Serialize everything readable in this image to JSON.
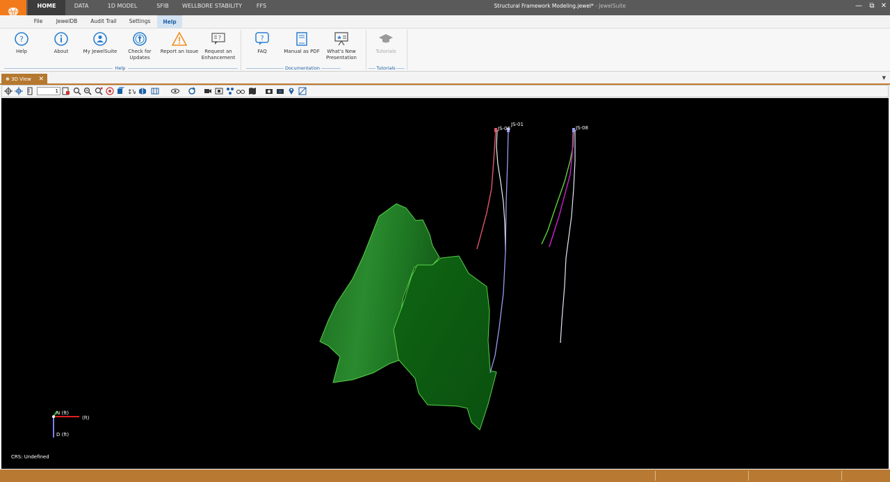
{
  "top_tabs": [
    "HOME",
    "DATA",
    "1D MODEL",
    "SFIB",
    "WELLBORE STABILITY",
    "FFS"
  ],
  "active_top_tab": "HOME",
  "window": {
    "document_title": "Structural Framework Modeling.jewel*",
    "app_name": " - JewelSuite"
  },
  "sub_tabs": [
    "File",
    "JewelDB",
    "Audit Trail",
    "Settings",
    "Help"
  ],
  "active_sub_tab": "Help",
  "ribbon": {
    "help_group": {
      "label": "Help",
      "buttons": [
        {
          "label": "Help",
          "icon": "help-circle-icon"
        },
        {
          "label": "About",
          "icon": "info-circle-icon"
        },
        {
          "label": "My JewelSuite",
          "icon": "user-circle-icon"
        },
        {
          "label": "Check for Updates",
          "icon": "update-arrow-icon"
        },
        {
          "label": "Report an Issue",
          "icon": "warning-triangle-icon"
        },
        {
          "label": "Request an Enhancement",
          "icon": "speech-bubble-icon"
        }
      ]
    },
    "documentation_group": {
      "label": "Documentation",
      "buttons": [
        {
          "label": "FAQ",
          "icon": "faq-bubble-icon"
        },
        {
          "label": "Manual as PDF",
          "icon": "book-icon"
        },
        {
          "label": "What's New Presentation",
          "icon": "presentation-board-icon"
        }
      ]
    },
    "tutorials_group": {
      "label": "Tutorials",
      "buttons": [
        {
          "label": "Tutorials",
          "icon": "graduation-cap-icon",
          "disabled": true
        }
      ]
    }
  },
  "doc_tab": {
    "label": "3D View",
    "icon": "3d-view-icon"
  },
  "viewer": {
    "zoom_value": "1",
    "well_labels": [
      "JS-06",
      "JS-01",
      "JS-08"
    ],
    "axis_labels": {
      "north": "N (ft)",
      "east": "(ft)",
      "depth": "D (ft)"
    },
    "crs_text": "CRS: Undefined"
  },
  "colors": {
    "accent_orange": "#f27a1a",
    "status_bar": "#b87a33",
    "surface_green_light": "#1f7a24",
    "surface_green_dark": "#0d5c10",
    "surface_outline": "#59d24a"
  }
}
